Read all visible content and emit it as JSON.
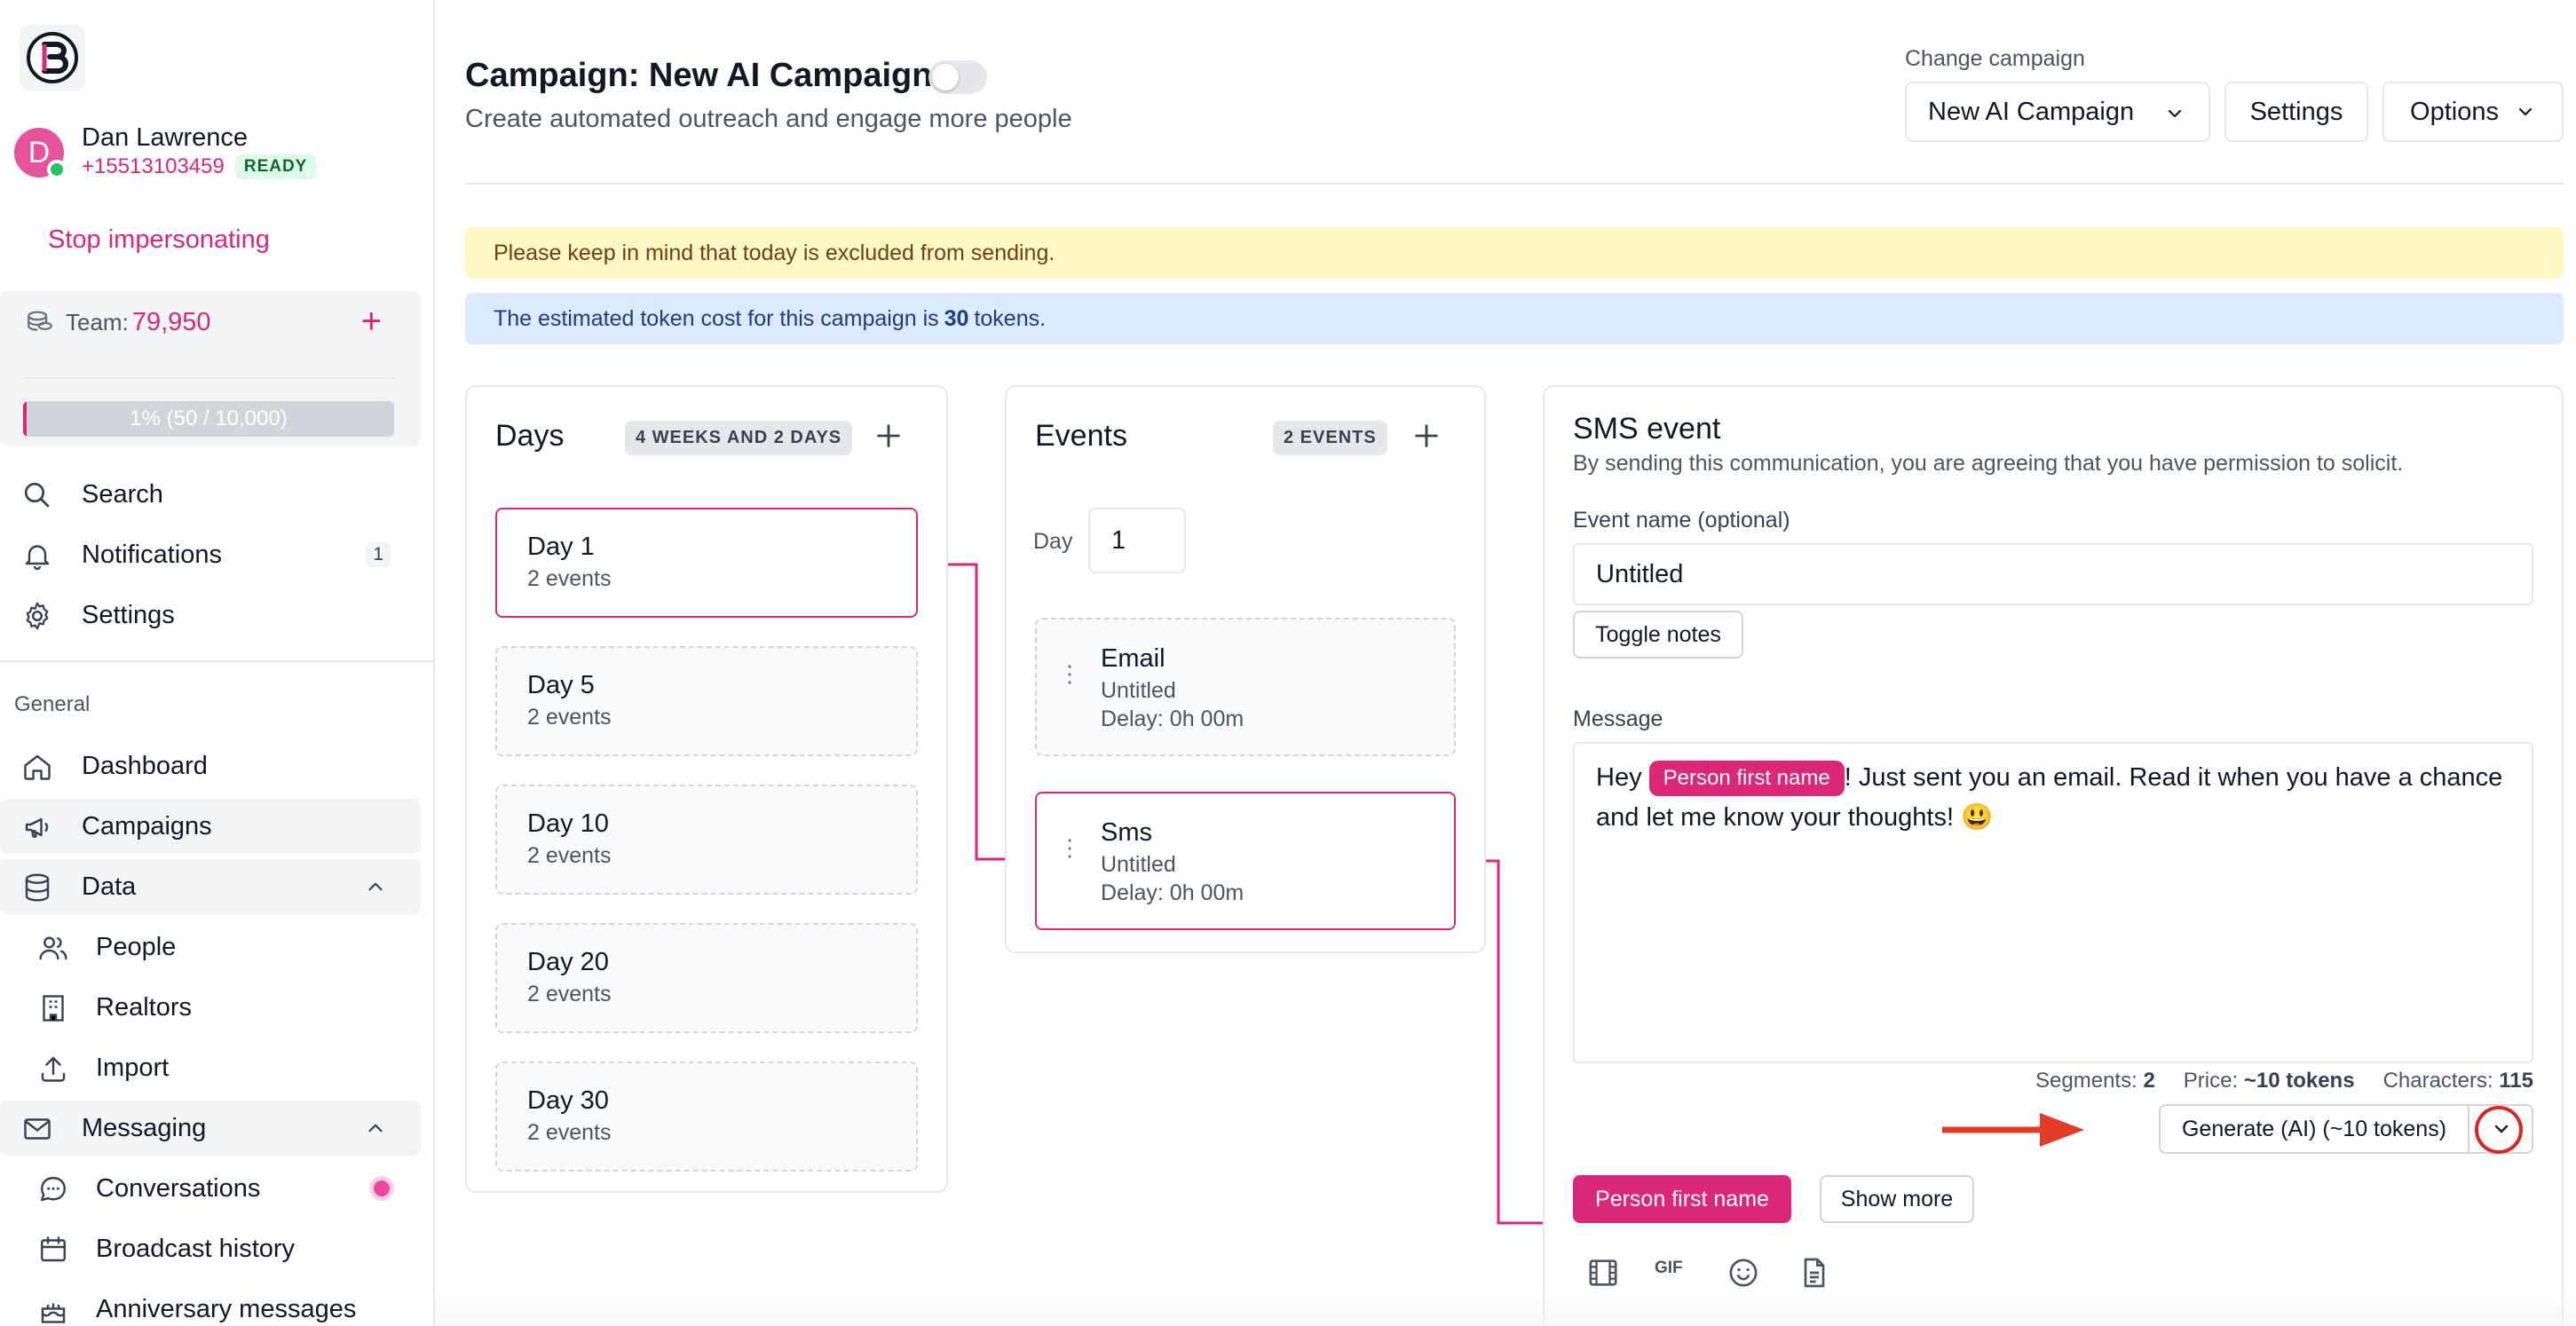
{
  "sidebar": {
    "user": {
      "initial": "D",
      "name": "Dan Lawrence",
      "phone": "+15513103459",
      "status": "READY"
    },
    "stop_impersonating": "Stop impersonating",
    "team": {
      "label": "Team:",
      "value": "79,950",
      "progress_text": "1% (50 / 10,000)",
      "progress_fraction": 0.01
    },
    "nav_top": [
      {
        "label": "Search",
        "icon": "search-icon"
      },
      {
        "label": "Notifications",
        "icon": "bell-icon",
        "badge": "1"
      },
      {
        "label": "Settings",
        "icon": "gear-icon"
      }
    ],
    "section": "General",
    "nav_general": {
      "dashboard": "Dashboard",
      "campaigns": "Campaigns",
      "data": "Data",
      "people": "People",
      "realtors": "Realtors",
      "import": "Import",
      "messaging": "Messaging",
      "conversations": "Conversations",
      "broadcast": "Broadcast history",
      "anniversary": "Anniversary messages"
    }
  },
  "header": {
    "title": "Campaign: New AI Campaign",
    "subtitle": "Create automated outreach and engage more people",
    "change_label": "Change campaign",
    "selected_campaign": "New AI Campaign",
    "settings_btn": "Settings",
    "options_btn": "Options"
  },
  "alerts": {
    "excluded": "Please keep in mind that today is excluded from sending.",
    "token_pre": "The estimated token cost for this campaign is",
    "token_value": "30",
    "token_post": "tokens."
  },
  "days": {
    "title": "Days",
    "pill": "4 WEEKS AND 2 DAYS",
    "items": [
      {
        "title": "Day 1",
        "sub": "2 events"
      },
      {
        "title": "Day 5",
        "sub": "2 events"
      },
      {
        "title": "Day 10",
        "sub": "2 events"
      },
      {
        "title": "Day 20",
        "sub": "2 events"
      },
      {
        "title": "Day 30",
        "sub": "2 events"
      }
    ]
  },
  "events": {
    "title": "Events",
    "pill": "2 EVENTS",
    "day_label": "Day",
    "day_value": "1",
    "items": [
      {
        "title": "Email",
        "name": "Untitled",
        "delay": "Delay: 0h 00m"
      },
      {
        "title": "Sms",
        "name": "Untitled",
        "delay": "Delay: 0h 00m"
      }
    ]
  },
  "sms": {
    "title": "SMS event",
    "desc": "By sending this communication, you are agreeing that you have permission to solicit.",
    "name_label": "Event name (optional)",
    "name_value": "Untitled",
    "toggle_notes": "Toggle notes",
    "message_label": "Message",
    "message_pre": "Hey",
    "message_chip": "Person first name",
    "message_post": "! Just sent you an email. Read it when you have a chance and let me know your thoughts! 😃",
    "segments_label": "Segments:",
    "segments_value": "2",
    "price_label": "Price:",
    "price_value": "~10 tokens",
    "chars_label": "Characters:",
    "chars_value": "115",
    "generate_btn": "Generate (AI) (~10 tokens)",
    "person_btn": "Person first name",
    "show_more": "Show more",
    "gif_label": "GIF"
  },
  "colors": {
    "accent": "#db2777",
    "annotation": "#e03c28"
  }
}
